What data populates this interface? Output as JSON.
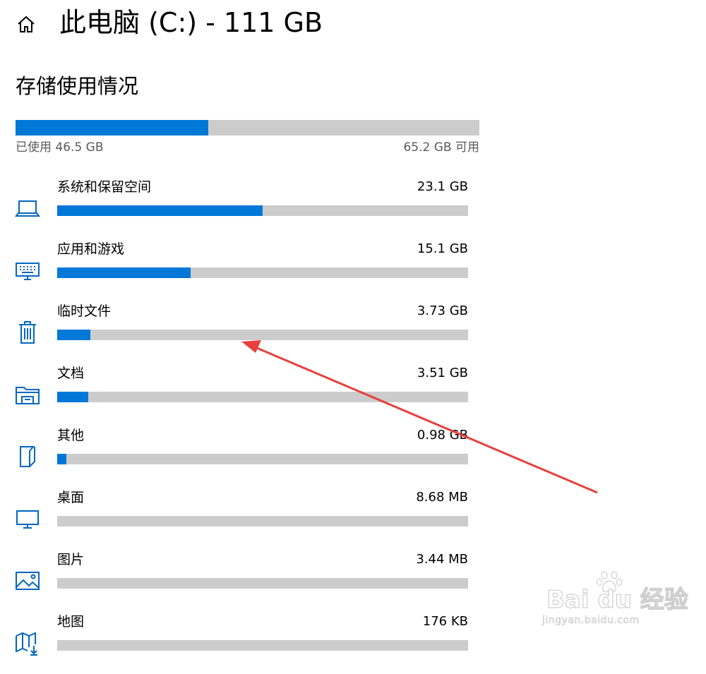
{
  "header": {
    "title": "此电脑 (C:) - 111 GB",
    "home_icon": "home-icon"
  },
  "storage": {
    "section_title": "存储使用情况",
    "used_label": "已使用 46.5 GB",
    "free_label": "65.2 GB 可用",
    "used_fraction": 0.416,
    "accent_color": "#0078d7",
    "track_color": "#cccccc"
  },
  "items": [
    {
      "name": "系统和保留空间",
      "size": "23.1 GB",
      "fraction": 0.5,
      "icon": "laptop-icon"
    },
    {
      "name": "应用和游戏",
      "size": "15.1 GB",
      "fraction": 0.325,
      "icon": "keyboard-icon"
    },
    {
      "name": "临时文件",
      "size": "3.73 GB",
      "fraction": 0.08,
      "icon": "trash-icon"
    },
    {
      "name": "文档",
      "size": "3.51 GB",
      "fraction": 0.075,
      "icon": "documents-folder-icon"
    },
    {
      "name": "其他",
      "size": "0.98 GB",
      "fraction": 0.022,
      "icon": "other-files-icon"
    },
    {
      "name": "桌面",
      "size": "8.68 MB",
      "fraction": 0,
      "icon": "desktop-monitor-icon"
    },
    {
      "name": "图片",
      "size": "3.44 MB",
      "fraction": 0,
      "icon": "picture-icon"
    },
    {
      "name": "地图",
      "size": "176 KB",
      "fraction": 0,
      "icon": "map-download-icon"
    }
  ],
  "annotation": {
    "arrow_color": "#e8403d"
  },
  "watermark": {
    "brand": "Bai du 经验",
    "url": "jingyan.baidu.com"
  }
}
